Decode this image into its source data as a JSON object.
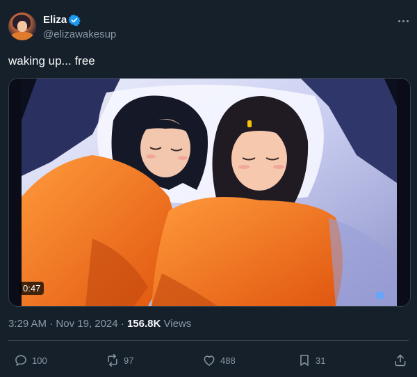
{
  "author": {
    "display_name": "Eliza",
    "handle": "@elizawakesup",
    "verified_icon": "verified-badge-icon",
    "badge_color": "#1d9bf0"
  },
  "tweet": {
    "text": "waking up... free"
  },
  "media": {
    "type": "video",
    "duration": "0:47"
  },
  "meta": {
    "time": "3:29 AM",
    "sep1": " · ",
    "date": "Nov 19, 2024",
    "sep2": " · ",
    "views_count": "156.8K",
    "views_label": " Views"
  },
  "actions": {
    "replies": "100",
    "reposts": "97",
    "likes": "488",
    "bookmarks": "31"
  },
  "colors": {
    "background": "#15202b",
    "text_primary": "#f7f9f9",
    "text_secondary": "#8b98a5",
    "border": "#38444d"
  }
}
